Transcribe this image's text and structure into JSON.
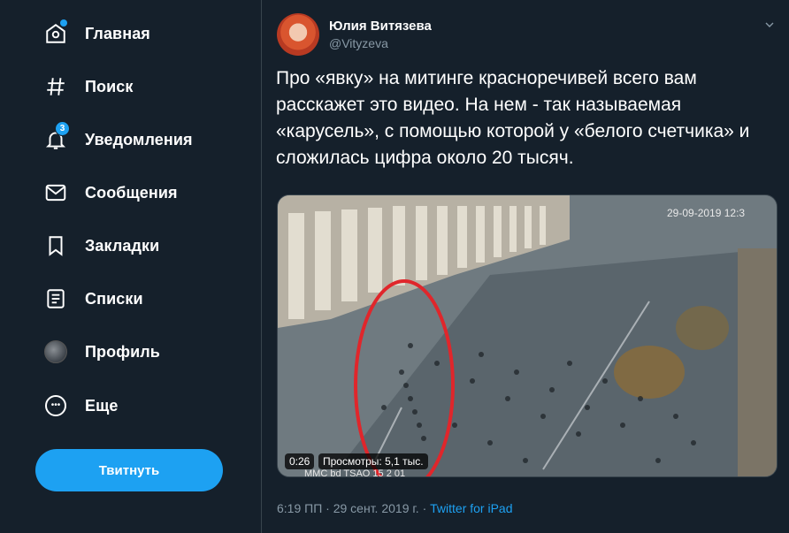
{
  "sidebar": {
    "items": [
      {
        "label": "Главная",
        "icon": "home-icon"
      },
      {
        "label": "Поиск",
        "icon": "hashtag-icon"
      },
      {
        "label": "Уведомления",
        "icon": "bell-icon",
        "badge": "3"
      },
      {
        "label": "Сообщения",
        "icon": "envelope-icon"
      },
      {
        "label": "Закладки",
        "icon": "bookmark-icon"
      },
      {
        "label": "Списки",
        "icon": "list-icon"
      },
      {
        "label": "Профиль",
        "icon": "avatar-icon"
      },
      {
        "label": "Еще",
        "icon": "more-icon",
        "more_glyph": "•••"
      }
    ],
    "tweet_button": "Твитнуть"
  },
  "tweet": {
    "author_name": "Юлия Витязева",
    "author_handle": "@Vityzeva",
    "text": "Про «явку» на митинге красноречивей всего вам расскажет это видео. На нем - так называемая «карусель», с помощью которой у «белого счетчика» и сложилась цифра около 20 тысяч.",
    "video": {
      "duration": "0:26",
      "views": "Просмотры: 5,1 тыс.",
      "overlay_timestamp": "29-09-2019 12:3",
      "overlay_caption": "ММС bd TSAO 15 2 01"
    },
    "meta": {
      "time": "6:19 ПП",
      "separator": "·",
      "date": "29 сент. 2019 г.",
      "source": "Twitter for iPad"
    }
  },
  "colors": {
    "background": "#15202b",
    "accent": "#1da1f2",
    "secondary_text": "#8899a6",
    "border": "#38444d"
  }
}
